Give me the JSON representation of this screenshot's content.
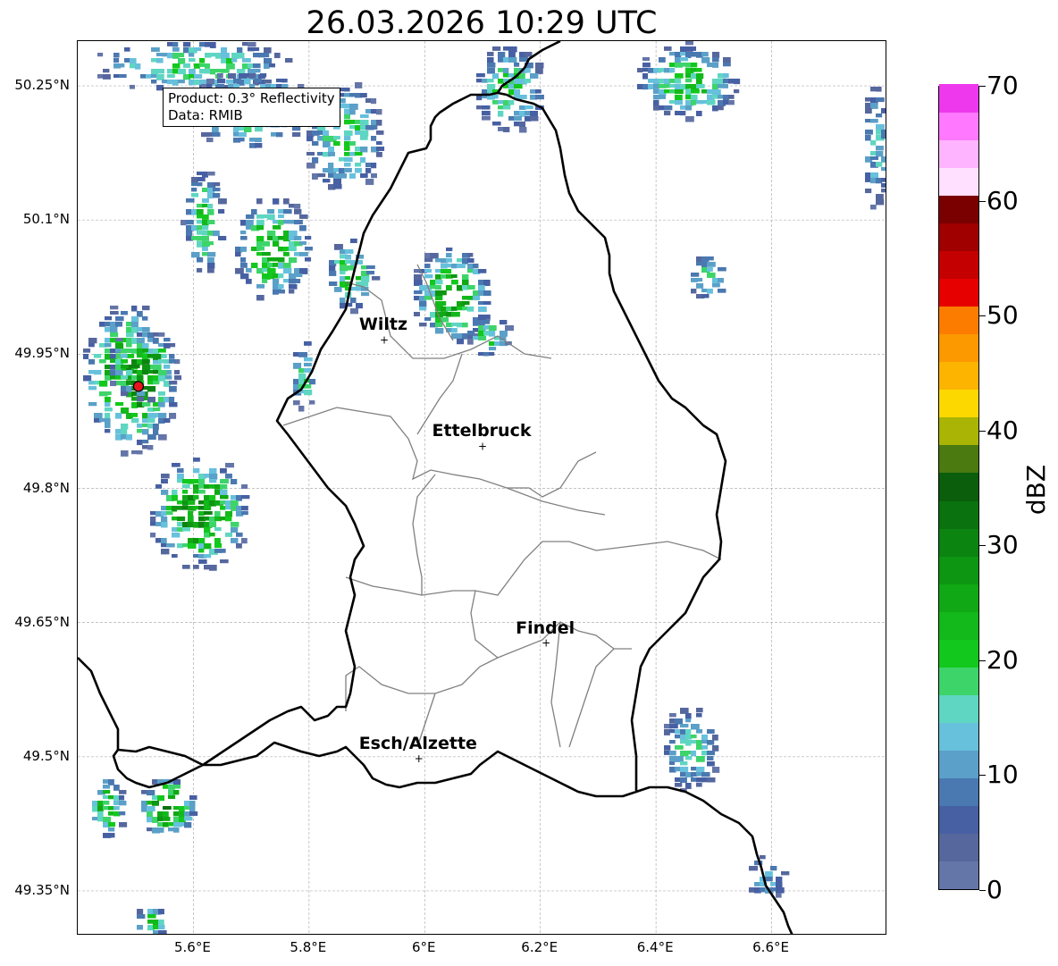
{
  "title": "26.03.2026 10:29 UTC",
  "info_box": {
    "product": "Product: 0.3° Reflectivity",
    "data": "Data: RMIB"
  },
  "lat_ticks": [
    "50.25°N",
    "50.1°N",
    "49.95°N",
    "49.8°N",
    "49.65°N",
    "49.5°N",
    "49.35°N"
  ],
  "lon_ticks": [
    "5.6°E",
    "5.8°E",
    "6°E",
    "6.2°E",
    "6.4°E",
    "6.6°E"
  ],
  "cities": [
    {
      "name": "Wiltz",
      "lon": 5.93,
      "lat": 49.966
    },
    {
      "name": "Ettelbruck",
      "lon": 6.1,
      "lat": 49.847
    },
    {
      "name": "Findel",
      "lon": 6.21,
      "lat": 49.627
    },
    {
      "name": "Esch/Alzette",
      "lon": 5.99,
      "lat": 49.498
    }
  ],
  "radar_site": {
    "lon": 5.505,
    "lat": 49.914,
    "color": "#e8141e"
  },
  "colorbar": {
    "unit": "dBZ",
    "ticks": [
      "0",
      "10",
      "20",
      "30",
      "40",
      "50",
      "60",
      "70"
    ],
    "colors": [
      "#6475a8",
      "#56679e",
      "#4760a3",
      "#4a78b0",
      "#5aa0c8",
      "#67c0dc",
      "#5ed6c2",
      "#3dd46a",
      "#12c81c",
      "#13b81a",
      "#10a814",
      "#0d9612",
      "#0c8410",
      "#0a720e",
      "#0a5e0c",
      "#4a7a10",
      "#aab404",
      "#fcd800",
      "#fcb400",
      "#fc9800",
      "#fc7c00",
      "#e60000",
      "#c40000",
      "#a00000",
      "#7a0000",
      "#ffe0ff",
      "#ffb4ff",
      "#ff78ff",
      "#ee38ee"
    ]
  },
  "map": {
    "border_color": "#000000",
    "canton_color": "#808080",
    "grid_color": "#b0b0b0"
  }
}
